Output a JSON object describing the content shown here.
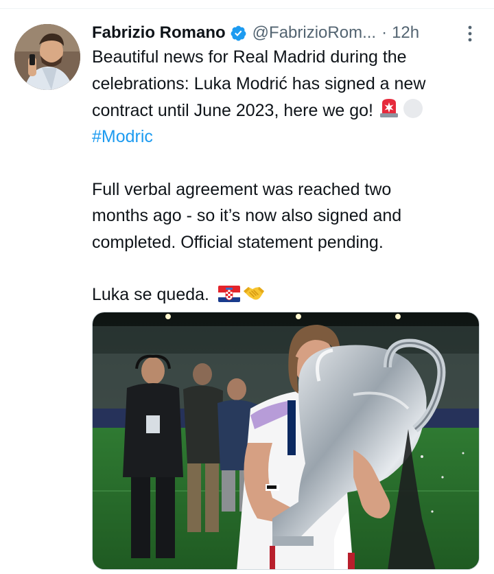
{
  "tweet": {
    "author_name": "Fabrizio Romano",
    "author_handle": "@FabrizioRom...",
    "separator": "·",
    "time": "12h",
    "line1": "Beautiful news for Real Madrid during the",
    "line2": "celebrations: Luka Modrić has signed a new",
    "line3": "contract until June 2023, here we go!",
    "hashtag": "#Modric",
    "para2_line1": "Full verbal agreement was reached two",
    "para2_line2": "months ago - so it’s now also signed and",
    "para2_line3": "completed. Official statement pending.",
    "para3": "Luka se queda."
  },
  "icons": {
    "verified": "verified-badge-icon",
    "more": "more-options-icon",
    "siren": "rotating-light-emoji",
    "circle": "white-circle-emoji",
    "flag": "croatia-flag-emoji",
    "handshake": "handshake-emoji"
  },
  "colors": {
    "text": "#0f1419",
    "secondary": "#536471",
    "link": "#1d9bf0",
    "verified": "#1d9bf0"
  }
}
